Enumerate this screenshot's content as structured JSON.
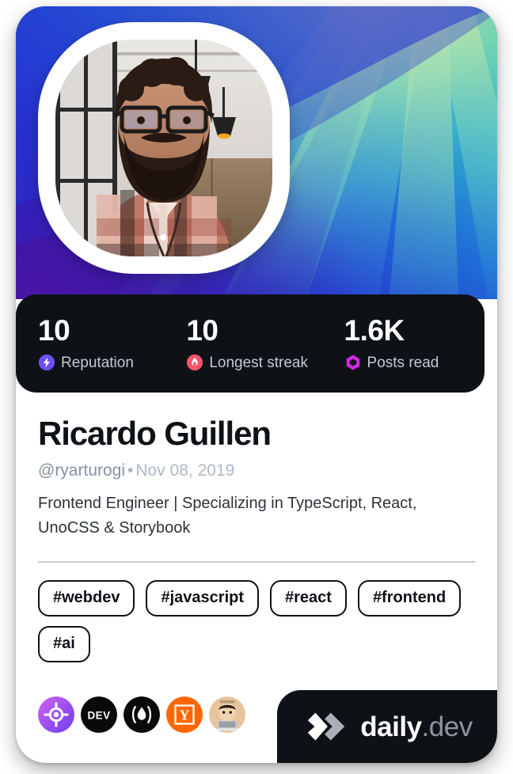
{
  "card": {
    "type": "devcard",
    "theme_background": "#ffffff"
  },
  "cover": {
    "style": "radiating-rays-gradient",
    "colors": [
      "#2a21c4",
      "#2746e0",
      "#1f8fd6",
      "#36c6c0",
      "#8fd98a",
      "#d6e89a",
      "#4a1f9e"
    ]
  },
  "avatar": {
    "alt": "Profile photo of Ricardo Guillen",
    "shape": "squircle",
    "border_color": "#ffffff"
  },
  "stats": [
    {
      "value": "10",
      "label": "Reputation",
      "icon": "bolt-icon",
      "color": "#6e4ff6"
    },
    {
      "value": "10",
      "label": "Longest streak",
      "icon": "flame-icon",
      "color": "#f8526b"
    },
    {
      "value": "1.6K",
      "label": "Posts read",
      "icon": "ring-hex-icon",
      "color": "#cf28e0"
    }
  ],
  "profile": {
    "name": "Ricardo Guillen",
    "handle": "@ryarturogi",
    "separator": "•",
    "joined": "Nov 08, 2019",
    "bio": "Frontend Engineer | Specializing in TypeScript, React, UnoCSS & Storybook"
  },
  "tags": [
    "#webdev",
    "#javascript",
    "#react",
    "#frontend",
    "#ai"
  ],
  "footer": {
    "sources": [
      {
        "name": "daily-dev-source-icon",
        "label": "daily.dev"
      },
      {
        "name": "devto-source-icon",
        "label": "DEV"
      },
      {
        "name": "hashnode-source-icon",
        "label": "Hashnode"
      },
      {
        "name": "hacker-news-source-icon",
        "label": "Y"
      },
      {
        "name": "user-avatar-source-icon",
        "label": "avatar"
      }
    ],
    "brand": {
      "name": "daily",
      "suffix": ".dev",
      "logo": "daily-dev-logo-icon",
      "background": "#0e1217"
    }
  }
}
